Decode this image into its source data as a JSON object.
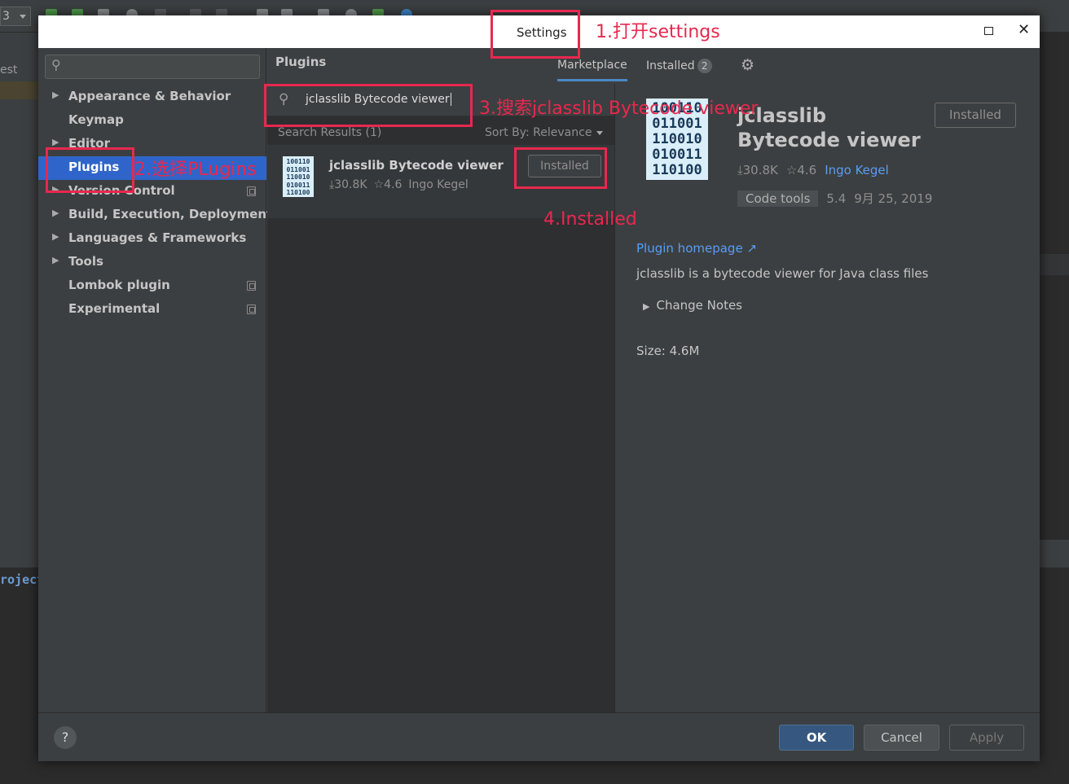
{
  "ide": {
    "toolbar_combo": "3",
    "left_fragment": "est",
    "bottom_fragment": "roject"
  },
  "dialog": {
    "title": "Settings"
  },
  "sidebar": {
    "items": [
      {
        "label": "Appearance & Behavior",
        "expandable": true
      },
      {
        "label": "Keymap",
        "expandable": false
      },
      {
        "label": "Editor",
        "expandable": true
      },
      {
        "label": "Plugins",
        "expandable": false,
        "selected": true
      },
      {
        "label": "Version Control",
        "expandable": true
      },
      {
        "label": "Build, Execution, Deployment",
        "expandable": true
      },
      {
        "label": "Languages & Frameworks",
        "expandable": true
      },
      {
        "label": "Tools",
        "expandable": true
      },
      {
        "label": "Lombok plugin",
        "expandable": false
      },
      {
        "label": "Experimental",
        "expandable": false
      }
    ]
  },
  "plugins": {
    "title": "Plugins",
    "tabs": {
      "marketplace": "Marketplace",
      "installed": "Installed",
      "installed_count": "2"
    },
    "search_value": "jclasslib Bytecode viewer",
    "results_label": "Search Results (1)",
    "sort_by": "Sort By: Relevance",
    "result": {
      "name": "jclasslib Bytecode viewer",
      "downloads": "⤓30.8K",
      "rating": "☆4.6",
      "author": "Ingo Kegel",
      "status": "Installed",
      "icon_lines": [
        "100110",
        "011001",
        "110010",
        "010011",
        "110100"
      ]
    }
  },
  "detail": {
    "name": "jclasslib Bytecode viewer",
    "status": "Installed",
    "downloads": "⤓30.8K",
    "rating": "☆4.6",
    "author": "Ingo Kegel",
    "tag": "Code tools",
    "version": "5.4",
    "date": "9月 25, 2019",
    "homepage": "Plugin homepage ↗",
    "description": "jclasslib is a bytecode viewer for Java class files",
    "change_notes": "Change Notes",
    "size": "Size: 4.6M"
  },
  "footer": {
    "help": "?",
    "ok": "OK",
    "cancel": "Cancel",
    "apply": "Apply"
  },
  "annotations": {
    "step1": "1.打开settings",
    "step2": "2.选择PLugins",
    "step3": "3.搜索jclasslib Bytecode viewer",
    "step4": "4.Installed",
    "color": "#e8284e"
  }
}
